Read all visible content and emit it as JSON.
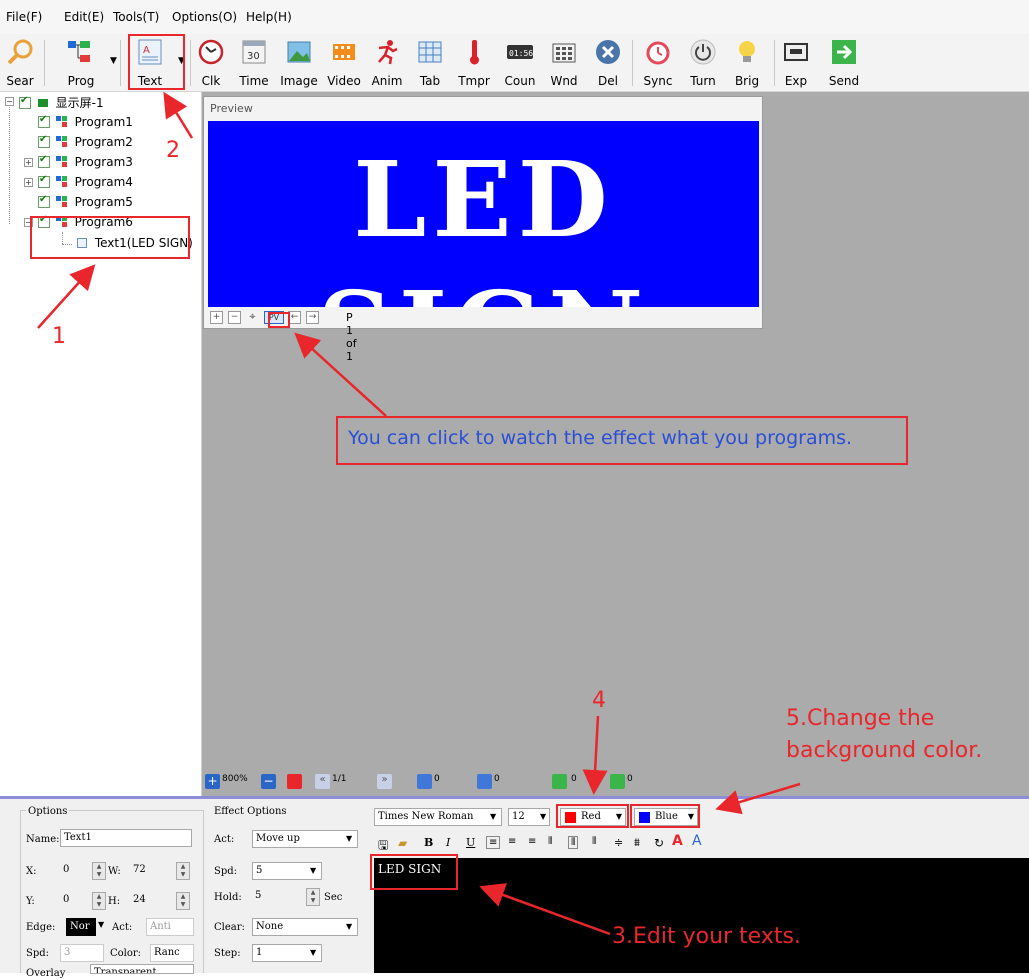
{
  "menu": [
    "File(F)",
    "Edit(E)",
    "Tools(T)",
    "Options(O)",
    "Help(H)"
  ],
  "toolbar": {
    "search": "Sear",
    "program": "Prog",
    "text": "Text",
    "clock": "Clk",
    "time": "Time",
    "image": "Image",
    "video": "Video",
    "animation": "Anim",
    "table": "Tab",
    "temperature": "Tmpr",
    "counter": "Coun",
    "window": "Wnd",
    "delete": "Del",
    "sync": "Sync",
    "turn": "Turn",
    "brightness": "Brig",
    "export": "Exp",
    "send": "Send",
    "time_icon_text": "30",
    "counter_icon_text": "01:56"
  },
  "tree": {
    "screen": "显示屏-1",
    "programs": [
      "Program1",
      "Program2",
      "Program3",
      "Program4",
      "Program5",
      "Program6"
    ],
    "text_item": "Text1(LED SIGN)"
  },
  "preview": {
    "title": "Preview",
    "led_text": "LED SIGN",
    "led_bg": "#0000ff",
    "led_fg": "#ffffff",
    "pv_label": "PV",
    "page": "P 1 of 1"
  },
  "work_bar": {
    "zoom": "800%",
    "page": "1/1",
    "v1": "0",
    "v2": "0",
    "v3": "0",
    "v4": "0"
  },
  "options": {
    "title": "Options",
    "name_label": "Name:",
    "name_value": "Text1",
    "x_label": "X:",
    "x_value": "0",
    "w_label": "W:",
    "w_value": "72",
    "y_label": "Y:",
    "y_value": "0",
    "h_label": "H:",
    "h_value": "24",
    "edge_label": "Edge:",
    "edge_value": "Nor",
    "act_label": "Act:",
    "act_value": "Anti",
    "spd_label": "Spd:",
    "spd_value": "3",
    "color_label": "Color:",
    "color_value": "Ranc",
    "overlay_label": "Overlay",
    "overlay_value": "Transparent"
  },
  "effect": {
    "title": "Effect Options",
    "act_label": "Act:",
    "act_value": "Move up",
    "spd_label": "Spd:",
    "spd_value": "5",
    "hold_label": "Hold:",
    "hold_value": "5",
    "hold_unit": "Sec",
    "clear_label": "Clear:",
    "clear_value": "None",
    "step_label": "Step:",
    "step_value": "1"
  },
  "format": {
    "font": "Times New Roman",
    "size": "12",
    "fg_color_name": "Red",
    "fg_color": "#ff0000",
    "bg_color_name": "Blue",
    "bg_color": "#0000ff",
    "bold": "B",
    "italic": "I",
    "underline": "U"
  },
  "editor": {
    "text": "LED SIGN"
  },
  "annotations": {
    "n1": "1",
    "n2": "2",
    "n4": "4",
    "hint": "You can click to watch the effect what you programs.",
    "step3": "3.Edit your texts.",
    "step5_line1": "5.Change the",
    "step5_line2": "background color."
  }
}
